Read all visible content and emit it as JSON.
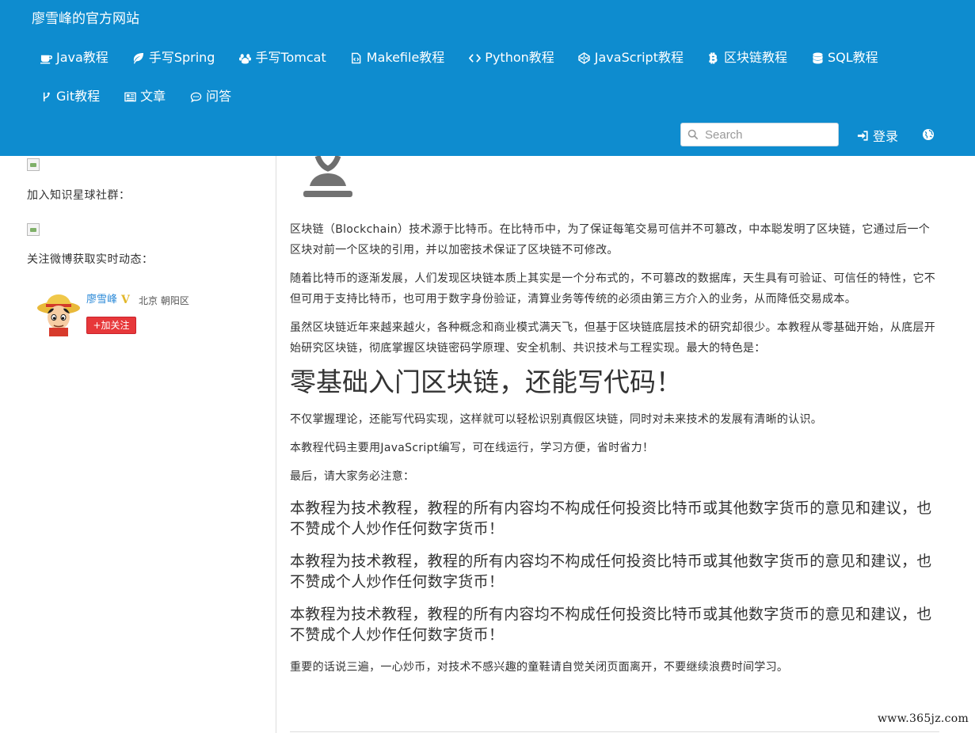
{
  "site": {
    "title": "廖雪峰的官方网站"
  },
  "nav": {
    "row1": [
      {
        "label": "Java教程",
        "icon": "coffee-icon"
      },
      {
        "label": "手写Spring",
        "icon": "leaf-icon"
      },
      {
        "label": "手写Tomcat",
        "icon": "paw-icon"
      },
      {
        "label": "Makefile教程",
        "icon": "file-code-icon"
      },
      {
        "label": "Python教程",
        "icon": "code-icon"
      },
      {
        "label": "JavaScript教程",
        "icon": "codepen-icon"
      },
      {
        "label": "区块链教程",
        "icon": "bitcoin-icon"
      },
      {
        "label": "SQL教程",
        "icon": "database-icon"
      }
    ],
    "row2": [
      {
        "label": "Git教程",
        "icon": "git-branch-icon"
      },
      {
        "label": "文章",
        "icon": "newspaper-icon"
      },
      {
        "label": "问答",
        "icon": "chat-icon"
      }
    ]
  },
  "search": {
    "placeholder": "Search",
    "icon": "search-icon"
  },
  "login": {
    "label": "登录",
    "icon": "sign-in-icon"
  },
  "globe": {
    "icon": "globe-icon"
  },
  "sidebar": {
    "zsxq_text": "加入知识星球社群：",
    "weibo_text": "关注微博获取实时动态：",
    "weibo": {
      "name": "廖雪峰",
      "badge": "V",
      "location": "北京 朝阳区",
      "follow_label": "+加关注"
    }
  },
  "article": {
    "p1": "区块链（Blockchain）技术源于比特币。在比特币中，为了保证每笔交易可信并不可篡改，中本聪发明了区块链，它通过后一个区块对前一个区块的引用，并以加密技术保证了区块链不可修改。",
    "p2": "随着比特币的逐渐发展，人们发现区块链本质上其实是一个分布式的，不可篡改的数据库，天生具有可验证、可信任的特性，它不但可用于支持比特币，也可用于数字身份验证，清算业务等传统的必须由第三方介入的业务，从而降低交易成本。",
    "p3": "虽然区块链近年来越来越火，各种概念和商业模式满天飞，但基于区块链底层技术的研究却很少。本教程从零基础开始，从底层开始研究区块链，彻底掌握区块链密码学原理、安全机制、共识技术与工程实现。最大的特色是：",
    "headline": "零基础入门区块链，还能写代码！",
    "p4": "不仅掌握理论，还能写代码实现，这样就可以轻松识别真假区块链，同时对未来技术的发展有清晰的认识。",
    "p5": "本教程代码主要用JavaScript编写，可在线运行，学习方便，省时省力！",
    "p6": "最后，请大家务必注意：",
    "warnings": [
      "本教程为技术教程，教程的所有内容均不构成任何投资比特币或其他数字货币的意见和建议，也不赞成个人炒作任何数字货币！",
      "本教程为技术教程，教程的所有内容均不构成任何投资比特币或其他数字货币的意见和建议，也不赞成个人炒作任何数字货币！",
      "本教程为技术教程，教程的所有内容均不构成任何投资比特币或其他数字货币的意见和建议，也不赞成个人炒作任何数字货币！"
    ],
    "p7": "重要的话说三遍，一心炒币，对技术不感兴趣的童鞋请自觉关闭页面离开，不要继续浪费时间学习。"
  },
  "watermark": {
    "text": "www.365jz.com"
  },
  "colors": {
    "header_bg": "#0e8ccf",
    "link": "#2e8bd8",
    "follow_button": "#e7383a",
    "body_text": "#333333"
  }
}
